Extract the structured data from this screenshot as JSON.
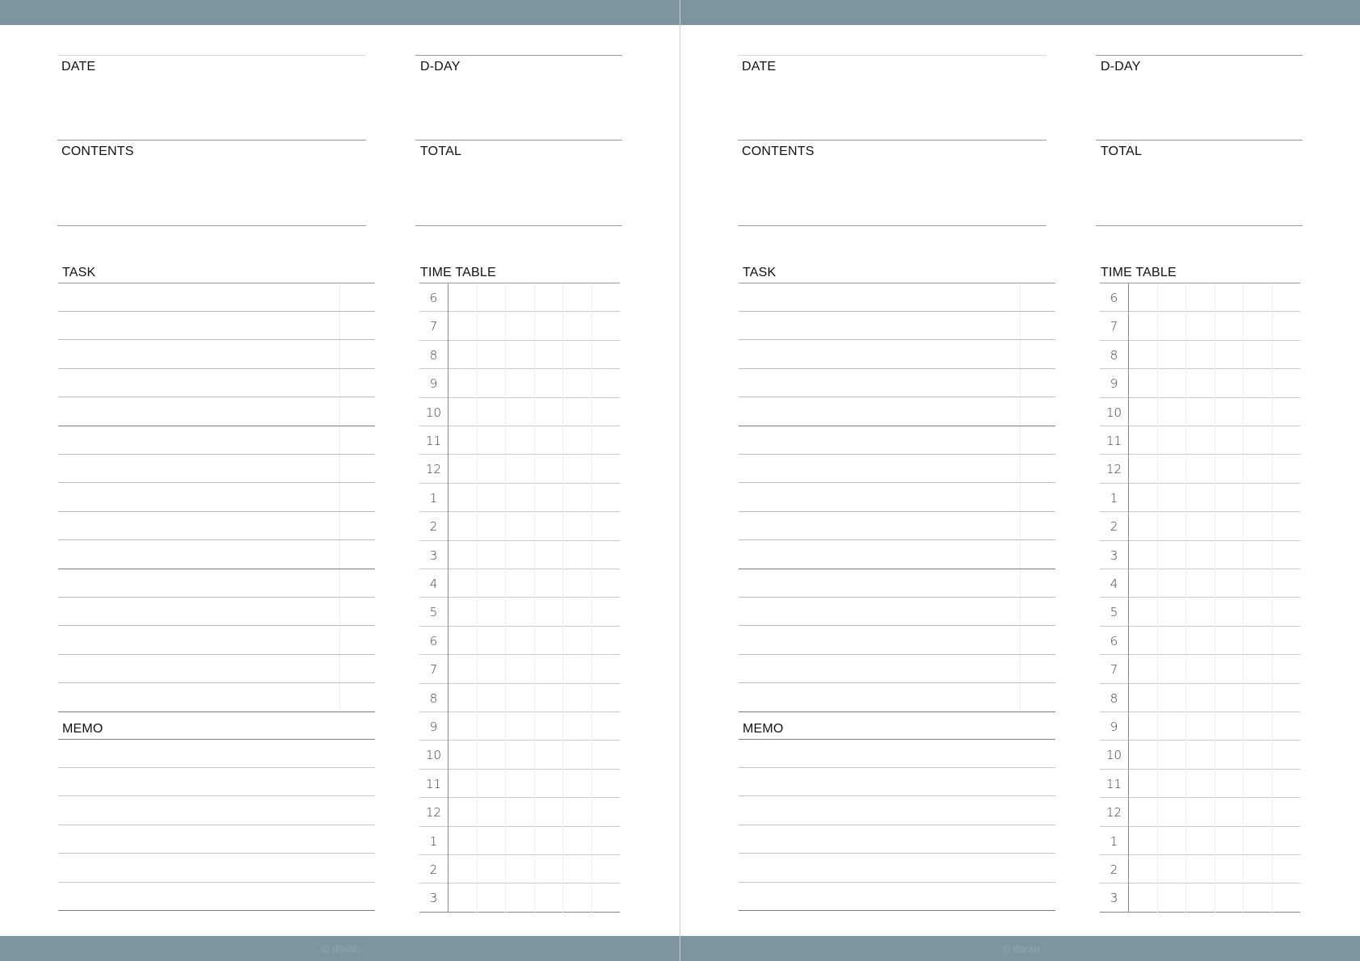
{
  "pages": [
    {
      "date_label": "DATE",
      "dday_label": "D-DAY",
      "contents_label": "CONTENTS",
      "total_label": "TOTAL",
      "task_label": "TASK",
      "timetable_label": "TIME TABLE",
      "memo_label": "MEMO",
      "credit": "© doran"
    },
    {
      "date_label": "DATE",
      "dday_label": "D-DAY",
      "contents_label": "CONTENTS",
      "total_label": "TOTAL",
      "task_label": "TASK",
      "timetable_label": "TIME TABLE",
      "memo_label": "MEMO",
      "credit": "© doran"
    }
  ],
  "hours": [
    "6",
    "7",
    "8",
    "9",
    "10",
    "11",
    "12",
    "1",
    "2",
    "3",
    "4",
    "5",
    "6",
    "7",
    "8",
    "9",
    "10",
    "11",
    "12",
    "1",
    "2",
    "3"
  ],
  "colors": {
    "band": "#7e95a0",
    "gutter": "#c9d1d6"
  }
}
